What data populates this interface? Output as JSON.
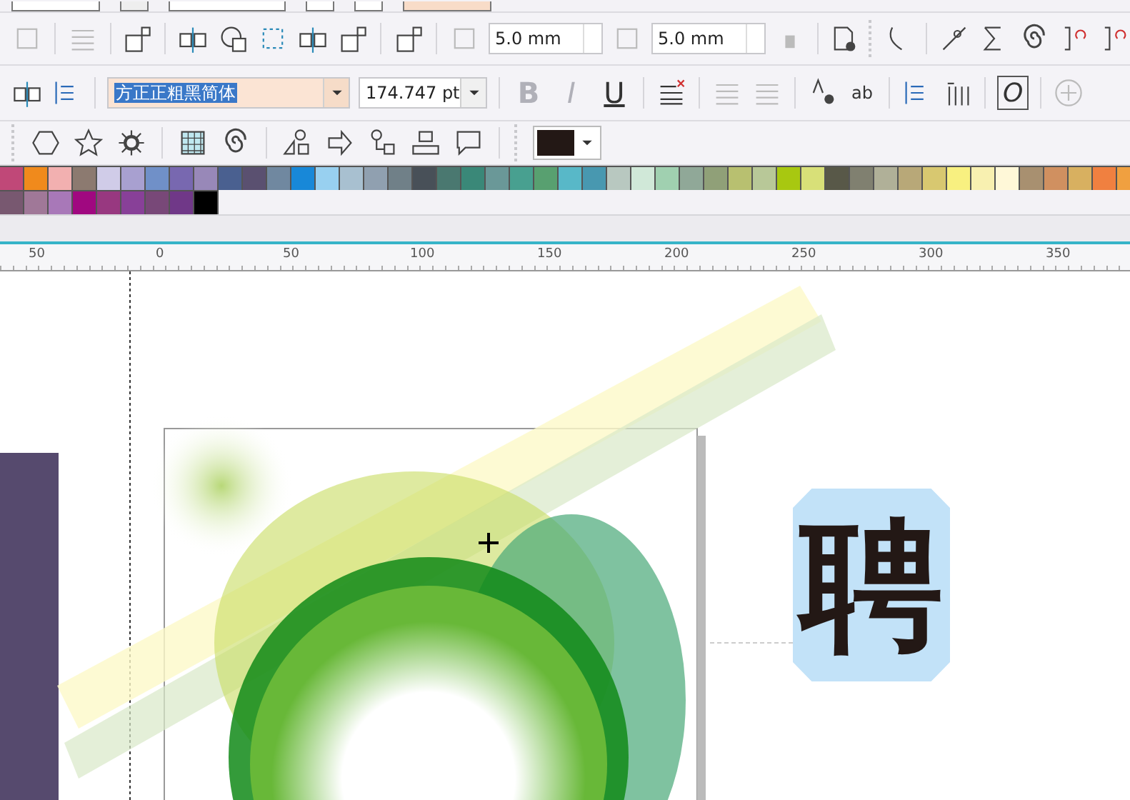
{
  "property_bar": {
    "width_field": {
      "value": "5.0 mm"
    },
    "height_field": {
      "value": "5.0 mm"
    }
  },
  "text_bar": {
    "font_field": {
      "value": "方正正粗黑简体",
      "text_selected": true
    },
    "size_field": {
      "value": "174.747 pt"
    },
    "style_buttons": [
      {
        "label": "B",
        "kind": "bold",
        "disabled": true
      },
      {
        "label": "I",
        "kind": "italic",
        "disabled": true
      },
      {
        "label": "U",
        "kind": "underline",
        "disabled": false
      }
    ],
    "edit_label": "ab",
    "italic_o": "O"
  },
  "palette": {
    "rows": [
      {
        "swatches": [
          {
            "color": "#c04878"
          },
          {
            "color": "#f08a1c"
          },
          {
            "color": "#f2b0b0"
          },
          {
            "color": "#8c7a70"
          },
          {
            "color": "#d0cce8"
          },
          {
            "color": "#a8a0d0"
          },
          {
            "color": "#7090c8"
          },
          {
            "color": "#7868b0"
          },
          {
            "color": "#9888b8"
          },
          {
            "color": "#4a6090"
          },
          {
            "color": "#5a5070"
          },
          {
            "color": "#7088a0"
          },
          {
            "color": "#1888d8"
          },
          {
            "color": "#98d0f0"
          },
          {
            "color": "#a8c0d0"
          },
          {
            "color": "#90a0b0"
          },
          {
            "color": "#708088"
          },
          {
            "color": "#485058"
          },
          {
            "color": "#4a7870"
          },
          {
            "color": "#3a8878"
          },
          {
            "color": "#6a9898"
          },
          {
            "color": "#48a090"
          },
          {
            "color": "#58a070"
          },
          {
            "color": "#58b8c8"
          },
          {
            "color": "#4898b0"
          },
          {
            "color": "#b8c8c0"
          },
          {
            "color": "#d0e8d8"
          },
          {
            "color": "#a0d0b0"
          },
          {
            "color": "#90a898"
          },
          {
            "color": "#90a078"
          },
          {
            "color": "#b8c070"
          },
          {
            "color": "#b8c898"
          },
          {
            "color": "#a8c810"
          },
          {
            "color": "#d8e078"
          },
          {
            "color": "#585848"
          },
          {
            "color": "#808070"
          },
          {
            "color": "#b0b098"
          },
          {
            "color": "#b8a878"
          },
          {
            "color": "#d8c870"
          },
          {
            "color": "#f8f080"
          },
          {
            "color": "#f8f0b0"
          },
          {
            "color": "#fff8d8"
          },
          {
            "color": "#a89070"
          },
          {
            "color": "#d09060"
          },
          {
            "color": "#d8b060"
          },
          {
            "color": "#f08040"
          },
          {
            "color": "#f0a040"
          }
        ]
      },
      {
        "swatches": [
          {
            "color": "#785870"
          },
          {
            "color": "#a07898"
          },
          {
            "color": "#a878b8"
          },
          {
            "color": "#a00880"
          },
          {
            "color": "#983880"
          },
          {
            "color": "#884098"
          },
          {
            "color": "#784878"
          },
          {
            "color": "#703888"
          },
          {
            "color": "#000000"
          }
        ]
      }
    ]
  },
  "ruler": {
    "labels": [
      "50",
      "0",
      "50",
      "100",
      "150",
      "200",
      "250",
      "300",
      "350"
    ]
  },
  "canvas": {
    "glyph": "聘"
  }
}
